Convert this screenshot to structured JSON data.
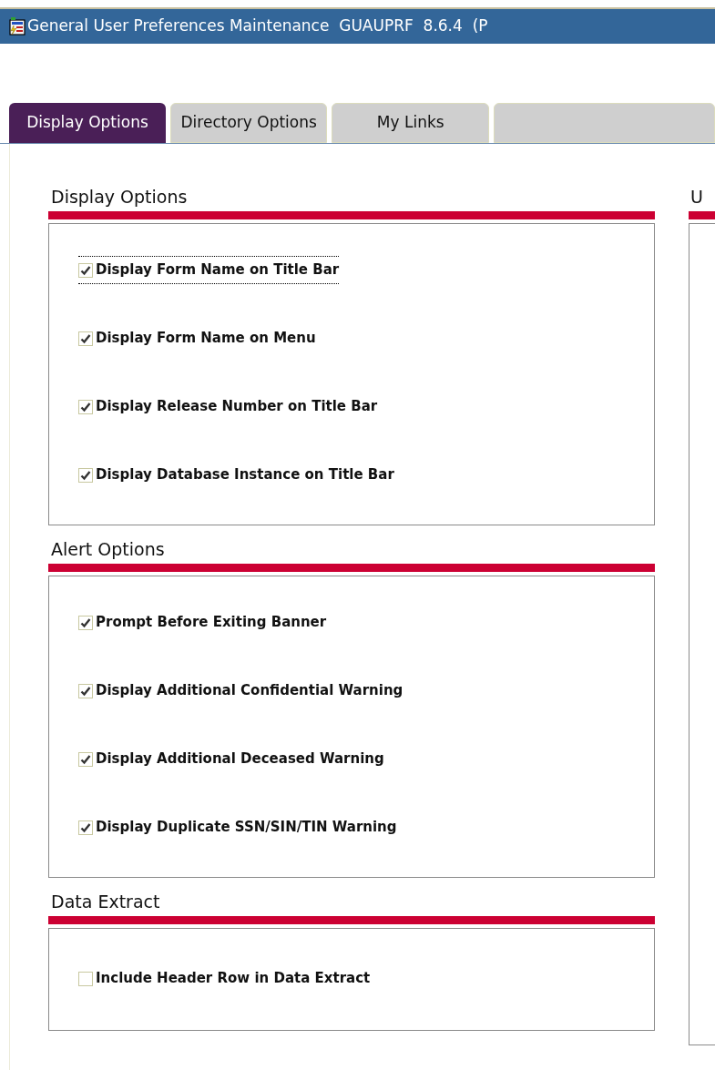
{
  "window": {
    "title": "General User Preferences Maintenance  GUAUPRF  8.6.4  (P"
  },
  "tabs": [
    {
      "label": "Display Options",
      "selected": true
    },
    {
      "label": "Directory Options",
      "selected": false
    },
    {
      "label": "My Links",
      "selected": false
    }
  ],
  "sections": [
    {
      "title": "Display Options",
      "options": [
        {
          "label": "Display Form Name on Title Bar",
          "checked": true,
          "focused": true
        },
        {
          "label": "Display Form Name on Menu",
          "checked": true,
          "focused": false
        },
        {
          "label": "Display Release Number on Title Bar",
          "checked": true,
          "focused": false
        },
        {
          "label": "Display Database Instance on Title Bar",
          "checked": true,
          "focused": false
        }
      ]
    },
    {
      "title": "Alert Options",
      "options": [
        {
          "label": "Prompt Before Exiting Banner",
          "checked": true,
          "focused": false
        },
        {
          "label": "Display Additional Confidential Warning",
          "checked": true,
          "focused": false
        },
        {
          "label": "Display Additional Deceased Warning",
          "checked": true,
          "focused": false
        },
        {
          "label": "Display Duplicate SSN/SIN/TIN Warning",
          "checked": true,
          "focused": false
        }
      ]
    },
    {
      "title": "Data Extract",
      "options": [
        {
          "label": "Include Header Row in Data Extract",
          "checked": false,
          "focused": false
        }
      ]
    }
  ],
  "right_section": {
    "title": "U"
  }
}
